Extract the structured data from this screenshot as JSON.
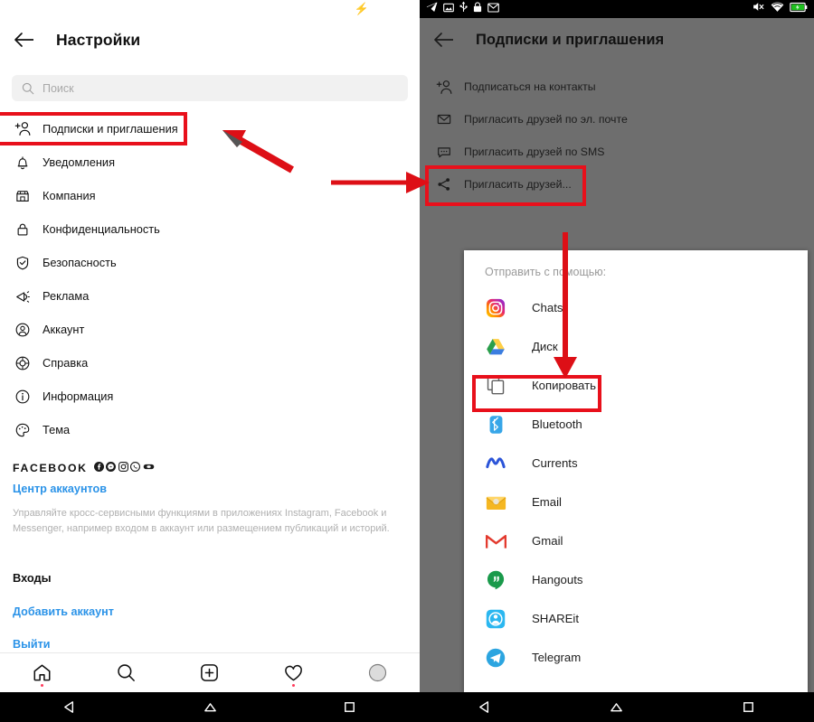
{
  "accent_red": "#e8101b",
  "link_blue": "#2b93e8",
  "left_phone": {
    "statusbar": {
      "charge_icon": "lightning-bolt-icon"
    },
    "header": {
      "back_icon": "back-arrow-icon",
      "title": "Настройки"
    },
    "search": {
      "icon": "search-icon",
      "placeholder": "Поиск",
      "value": ""
    },
    "menu_items": [
      {
        "icon": "add-person-icon",
        "label": "Подписки и приглашения"
      },
      {
        "icon": "bell-icon",
        "label": "Уведомления"
      },
      {
        "icon": "store-icon",
        "label": "Компания"
      },
      {
        "icon": "lock-icon",
        "label": "Конфиденциальность"
      },
      {
        "icon": "shield-check-icon",
        "label": "Безопасность"
      },
      {
        "icon": "megaphone-icon",
        "label": "Реклама"
      },
      {
        "icon": "account-circle-icon",
        "label": "Аккаунт"
      },
      {
        "icon": "lifebuoy-icon",
        "label": "Справка"
      },
      {
        "icon": "info-circle-icon",
        "label": "Информация"
      },
      {
        "icon": "palette-icon",
        "label": "Тема"
      }
    ],
    "facebook_block": {
      "word": "FACEBOOK",
      "brand_icons": [
        "facebook-icon",
        "messenger-icon",
        "instagram-icon",
        "whatsapp-icon",
        "portal-icon"
      ],
      "accounts_center_link": "Центр аккаунтов",
      "description": "Управляйте кросс-сервисными функциями в приложениях Instagram, Facebook и Messenger, например входом в аккаунт или размещением публикаций и историй."
    },
    "logins_section": {
      "heading": "Входы",
      "add_account_link": "Добавить аккаунт",
      "logout_link": "Выйти"
    },
    "bottom_nav": [
      {
        "icon": "home-icon",
        "badge": true
      },
      {
        "icon": "search-icon",
        "badge": false
      },
      {
        "icon": "plus-square-icon",
        "badge": false
      },
      {
        "icon": "heart-icon",
        "badge": true
      },
      {
        "icon": "avatar-circle-icon",
        "badge": false
      }
    ],
    "system_nav": [
      {
        "icon": "android-back-icon"
      },
      {
        "icon": "android-home-icon"
      },
      {
        "icon": "android-recents-icon"
      }
    ]
  },
  "right_phone": {
    "statusbar": {
      "left_icons": [
        "telegram-icon",
        "screenshot-icon",
        "usb-icon",
        "lock-icon",
        "gmail-icon"
      ],
      "right_icons": [
        "mute-icon",
        "wifi-icon",
        "battery-charging-icon"
      ]
    },
    "header": {
      "back_icon": "back-arrow-icon",
      "title": "Подписки и приглашения"
    },
    "menu_items": [
      {
        "icon": "add-person-icon",
        "label": "Подписаться на контакты"
      },
      {
        "icon": "envelope-icon",
        "label": "Пригласить друзей по эл. почте"
      },
      {
        "icon": "sms-bubble-icon",
        "label": "Пригласить друзей по SMS"
      },
      {
        "icon": "share-nodes-icon",
        "label": "Пригласить друзей..."
      }
    ],
    "share_sheet": {
      "title": "Отправить с помощью:",
      "apps": [
        {
          "icon": "instagram-icon",
          "label": "Chats"
        },
        {
          "icon": "google-drive-icon",
          "label": "Диск"
        },
        {
          "icon": "copy-icon",
          "label": "Копировать"
        },
        {
          "icon": "bluetooth-icon",
          "label": "Bluetooth"
        },
        {
          "icon": "currents-icon",
          "label": "Currents"
        },
        {
          "icon": "email-icon",
          "label": "Email"
        },
        {
          "icon": "gmail-icon",
          "label": "Gmail"
        },
        {
          "icon": "hangouts-icon",
          "label": "Hangouts"
        },
        {
          "icon": "shareit-icon",
          "label": "SHAREit"
        },
        {
          "icon": "telegram-icon",
          "label": "Telegram"
        }
      ]
    },
    "system_nav": [
      {
        "icon": "android-back-icon"
      },
      {
        "icon": "android-home-icon"
      },
      {
        "icon": "android-recents-icon"
      }
    ]
  },
  "annotations": {
    "boxes": [
      {
        "name": "highlight-subscriptions-invites"
      },
      {
        "name": "highlight-invite-friends"
      },
      {
        "name": "highlight-copy"
      }
    ],
    "arrows": [
      {
        "name": "arrow-to-subscriptions"
      },
      {
        "name": "arrow-to-right-screen"
      },
      {
        "name": "arrow-to-copy"
      }
    ]
  }
}
